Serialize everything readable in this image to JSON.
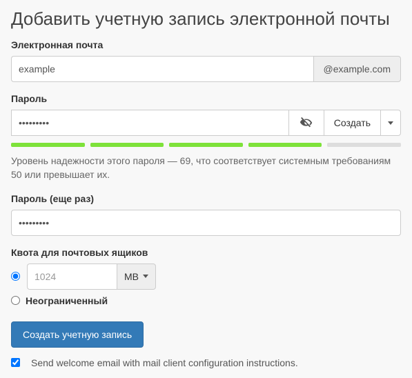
{
  "title": "Добавить учетную запись электронной почты",
  "email": {
    "label": "Электронная почта",
    "value": "example",
    "domain_suffix": "@example.com"
  },
  "password": {
    "label": "Пароль",
    "value": "•••••••••",
    "generate_label": "Создать",
    "strength": {
      "segments_on": 4,
      "segments_total": 5,
      "text": "Уровень надежности этого пароля — 69, что соответствует системным требованиям 50 или превышает их."
    }
  },
  "password_confirm": {
    "label": "Пароль (еще раз)",
    "value": "•••••••••"
  },
  "quota": {
    "label": "Квота для почтовых ящиков",
    "value": "1024",
    "unit": "MB",
    "unlimited_label": "Неограниченный",
    "selected": "fixed"
  },
  "submit_label": "Создать учетную запись",
  "welcome_email": {
    "checked": true,
    "label": "Send welcome email with mail client configuration instructions."
  }
}
